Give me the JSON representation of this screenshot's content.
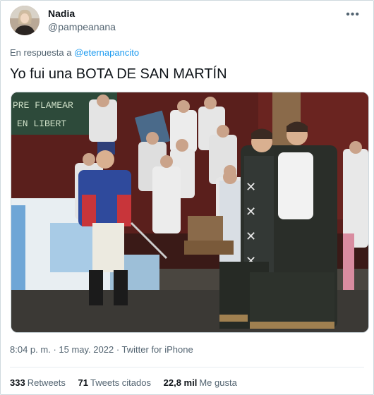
{
  "user": {
    "name": "Nadia",
    "handle": "@pampeanana"
  },
  "more_icon": "ellipsis-icon",
  "reply": {
    "prefix": "En respuesta a",
    "to": "@eternapancito"
  },
  "tweet": {
    "text": "Yo fui una BOTA DE SAN MARTÍN"
  },
  "photo": {
    "banner_line1": "PRE FLAMEAR",
    "banner_line2": "EN LIBERT"
  },
  "meta": {
    "time": "8:04 p. m.",
    "date": "15 may. 2022",
    "source": "Twitter for iPhone"
  },
  "stats": [
    {
      "count": "333",
      "label": "Retweets"
    },
    {
      "count": "71",
      "label": "Tweets citados"
    },
    {
      "count": "22,8 mil",
      "label": "Me gusta"
    }
  ],
  "colors": {
    "link": "#1d9bf0",
    "secondary": "#536471"
  }
}
